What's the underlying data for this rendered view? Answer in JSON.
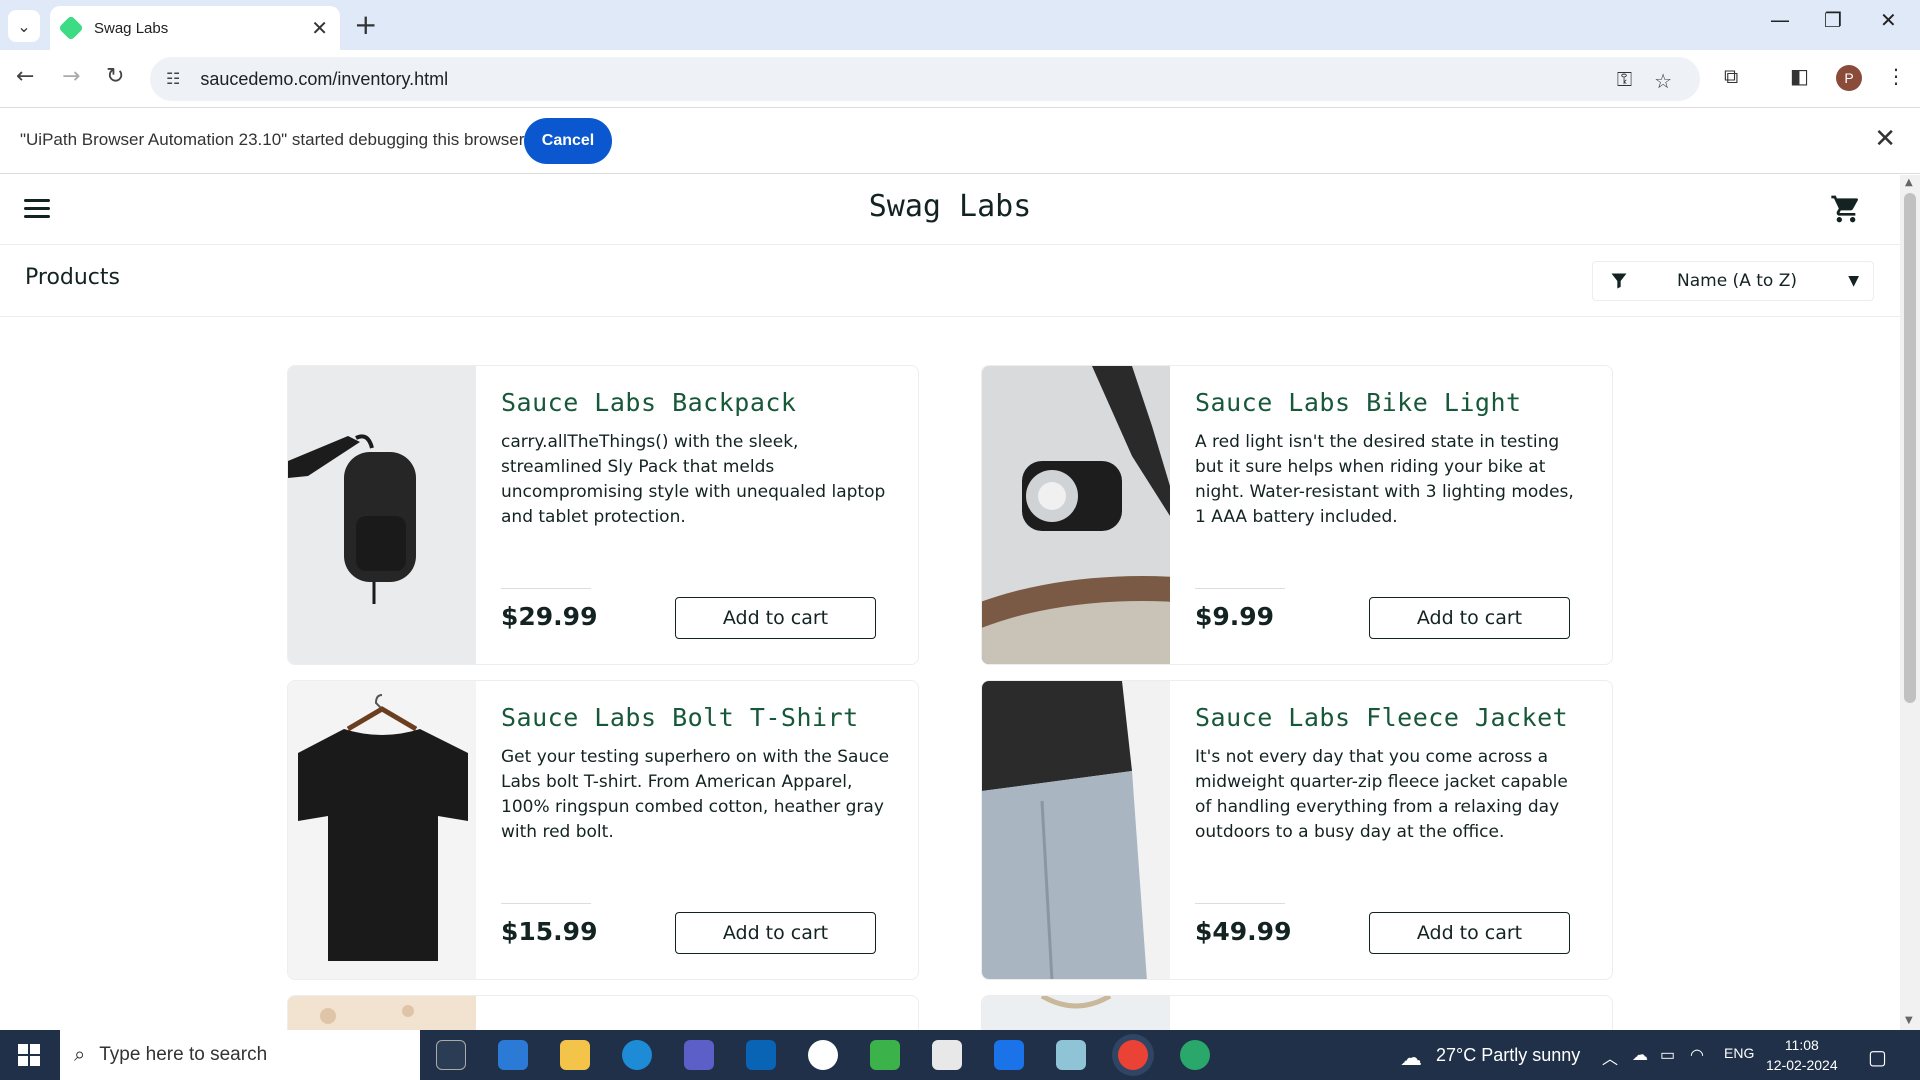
{
  "browser": {
    "tab_title": "Swag Labs",
    "url": "saucedemo.com/inventory.html",
    "profile_initial": "P"
  },
  "infobar": {
    "message": "\"UiPath Browser Automation 23.10\" started debugging this browser",
    "cancel_label": "Cancel"
  },
  "app": {
    "logo": "Swag Labs",
    "page_title": "Products",
    "sort_selected": "Name (A to Z)"
  },
  "products": [
    {
      "name": "Sauce Labs Backpack",
      "description": "carry.allTheThings() with the sleek, streamlined Sly Pack that melds uncompromising style with unequaled laptop and tablet protection.",
      "price": "$29.99",
      "button": "Add to cart"
    },
    {
      "name": "Sauce Labs Bike Light",
      "description": "A red light isn't the desired state in testing but it sure helps when riding your bike at night. Water-resistant with 3 lighting modes, 1 AAA battery included.",
      "price": "$9.99",
      "button": "Add to cart"
    },
    {
      "name": "Sauce Labs Bolt T-Shirt",
      "description": "Get your testing superhero on with the Sauce Labs bolt T-shirt. From American Apparel, 100% ringspun combed cotton, heather gray with red bolt.",
      "price": "$15.99",
      "button": "Add to cart"
    },
    {
      "name": "Sauce Labs Fleece Jacket",
      "description": "It's not every day that you come across a midweight quarter-zip fleece jacket capable of handling everything from a relaxing day outdoors to a busy day at the office.",
      "price": "$49.99",
      "button": "Add to cart"
    }
  ],
  "taskbar": {
    "search_placeholder": "Type here to search",
    "weather": "27°C  Partly sunny",
    "language": "ENG",
    "time": "11:08",
    "date": "12-02-2024"
  },
  "colors": {
    "accent": "#0b57d0",
    "product_name": "#18583a",
    "text": "#132322"
  }
}
